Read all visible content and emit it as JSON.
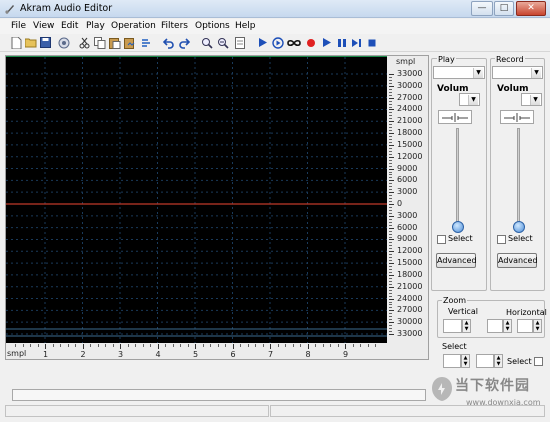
{
  "window": {
    "title": "Akram Audio Editor",
    "minimize_glyph": "—",
    "maximize_glyph": "□",
    "close_glyph": "✕"
  },
  "menu": [
    "File",
    "View",
    "Edit",
    "Play",
    "Operation",
    "Filters",
    "Options",
    "Help"
  ],
  "toolbar": [
    "new-icon",
    "open-icon",
    "save-icon",
    "record-settings-icon",
    "cut-icon",
    "copy-icon",
    "paste-icon",
    "mix-paste-icon",
    "undo-icon",
    "redo-icon",
    "zoom-in-icon",
    "zoom-out-icon",
    "zoom-fit-icon",
    "play-icon",
    "play-selection-icon",
    "loop-icon",
    "record-icon",
    "play-from-cursor-icon",
    "pause-icon",
    "play-to-end-icon",
    "stop-icon"
  ],
  "waveform": {
    "y_unit": "smpl",
    "y_ticks": [
      "33000",
      "30000",
      "27000",
      "24000",
      "21000",
      "18000",
      "15000",
      "12000",
      "9000",
      "6000",
      "3000",
      "0",
      "3000",
      "6000",
      "9000",
      "12000",
      "15000",
      "18000",
      "21000",
      "24000",
      "27000",
      "30000",
      "33000"
    ],
    "x_unit": "smpl",
    "x_ticks": [
      "1",
      "2",
      "3",
      "4",
      "5",
      "6",
      "7",
      "8",
      "9"
    ],
    "colors": {
      "background": "#000000",
      "center_line": "#c0392b",
      "grid": "#1a3a5a",
      "overview": "#2ecc71"
    }
  },
  "play_panel": {
    "title": "Play",
    "device": "",
    "volume_label": "Volum",
    "volume_value": "",
    "volume_level": 0,
    "select_label": "Select",
    "advanced_label": "Advanced"
  },
  "record_panel": {
    "title": "Record",
    "device": "",
    "volume_label": "Volum",
    "volume_value": "",
    "volume_level": 0,
    "select_label": "Select",
    "advanced_label": "Advanced"
  },
  "zoom": {
    "title": "Zoom",
    "vertical_label": "Vertical",
    "horizontal_label": "Horizontal"
  },
  "select": {
    "title": "Select",
    "check_label": "Select"
  },
  "watermark": {
    "cn": "当下软件园",
    "url": "www.downxia.com"
  }
}
